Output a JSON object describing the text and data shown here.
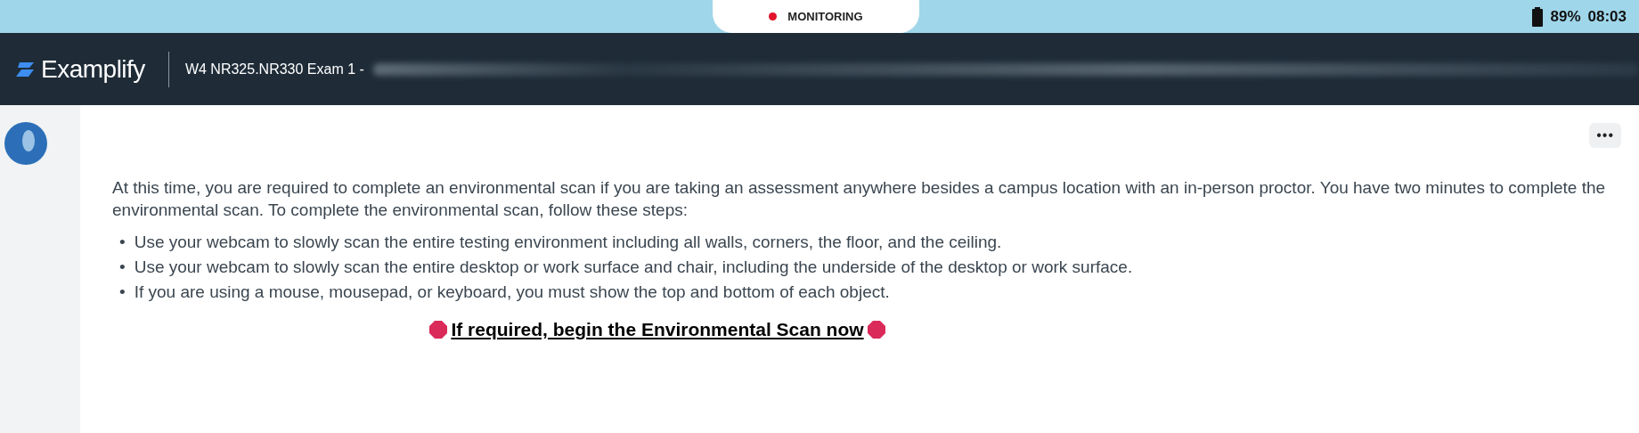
{
  "status_bar": {
    "monitoring": "MONITORING",
    "battery": "89%",
    "time": "08:03"
  },
  "header": {
    "logo": "Examplify",
    "exam_title": "W4 NR325.NR330 Exam 1 -"
  },
  "menu_button": "•••",
  "intro": "At this time, you are required to complete an environmental scan if you are taking an assessment anywhere besides a campus location with an in-person proctor. You have two minutes to complete the environmental scan. To complete the environmental scan, follow these steps:",
  "steps": [
    {
      "marker": "•",
      "text": "Use your webcam to slowly scan the entire testing environment including all walls, corners, the floor, and the ceiling."
    },
    {
      "marker": "•",
      "text": "Use your webcam to slowly scan the entire desktop or work surface and chair, including the underside of the desktop or work surface."
    },
    {
      "marker": "•",
      "text": "If you are using a mouse, mousepad, or keyboard, you must show the top and bottom of each object."
    }
  ],
  "scan_link": "If required, begin the Environmental Scan now"
}
